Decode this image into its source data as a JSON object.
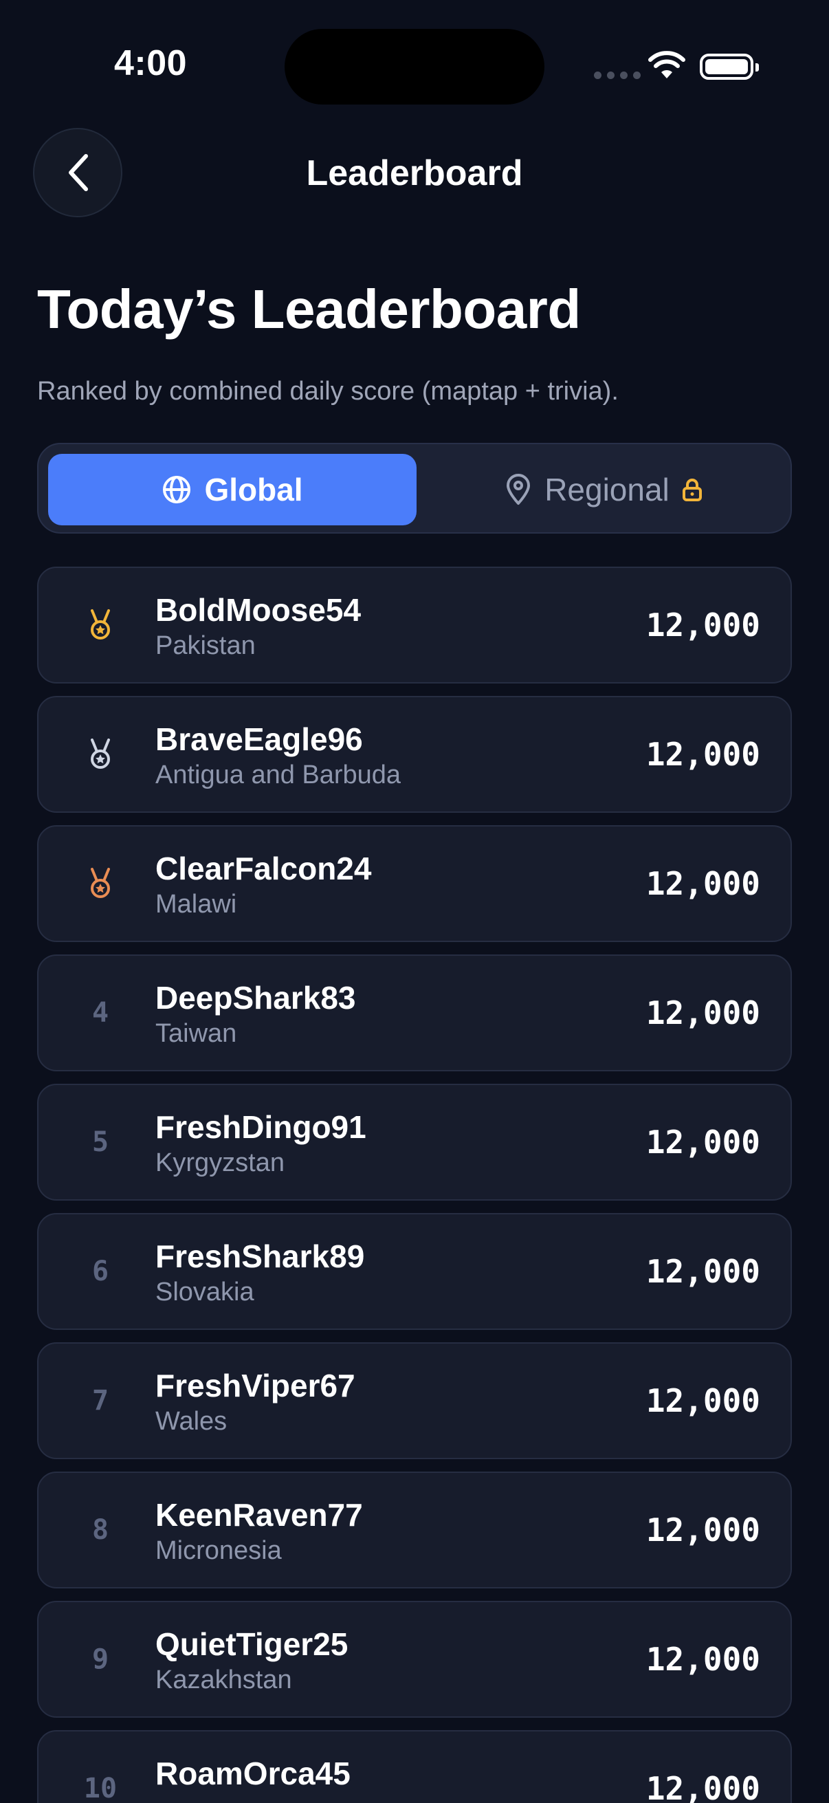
{
  "status": {
    "time": "4:00"
  },
  "nav": {
    "title": "Leaderboard",
    "back_icon": "chevron-left-icon"
  },
  "header": {
    "title": "Today’s Leaderboard",
    "subtitle": "Ranked by combined daily score (maptap + trivia)."
  },
  "tabs": {
    "global": {
      "label": "Global",
      "icon": "globe-icon",
      "selected": true
    },
    "regional": {
      "label": "Regional",
      "icon": "map-pin-icon",
      "lock_icon": "lock-icon",
      "locked": true
    }
  },
  "colors": {
    "accent": "#4b7dfa",
    "gold": "#f2b53a",
    "silver": "#cfd5e3",
    "bronze": "#e98d54",
    "lock": "#f2b53a"
  },
  "entries": [
    {
      "rank": "1",
      "medal": "gold",
      "name": "BoldMoose54",
      "country": "Pakistan",
      "score": "12,000"
    },
    {
      "rank": "2",
      "medal": "silver",
      "name": "BraveEagle96",
      "country": "Antigua and Barbuda",
      "score": "12,000"
    },
    {
      "rank": "3",
      "medal": "bronze",
      "name": "ClearFalcon24",
      "country": "Malawi",
      "score": "12,000"
    },
    {
      "rank": "4",
      "medal": "",
      "name": "DeepShark83",
      "country": "Taiwan",
      "score": "12,000"
    },
    {
      "rank": "5",
      "medal": "",
      "name": "FreshDingo91",
      "country": "Kyrgyzstan",
      "score": "12,000"
    },
    {
      "rank": "6",
      "medal": "",
      "name": "FreshShark89",
      "country": "Slovakia",
      "score": "12,000"
    },
    {
      "rank": "7",
      "medal": "",
      "name": "FreshViper67",
      "country": "Wales",
      "score": "12,000"
    },
    {
      "rank": "8",
      "medal": "",
      "name": "KeenRaven77",
      "country": "Micronesia",
      "score": "12,000"
    },
    {
      "rank": "9",
      "medal": "",
      "name": "QuietTiger25",
      "country": "Kazakhstan",
      "score": "12,000"
    },
    {
      "rank": "10",
      "medal": "",
      "name": "RoamOrca45",
      "country": "",
      "score": "12,000"
    }
  ]
}
